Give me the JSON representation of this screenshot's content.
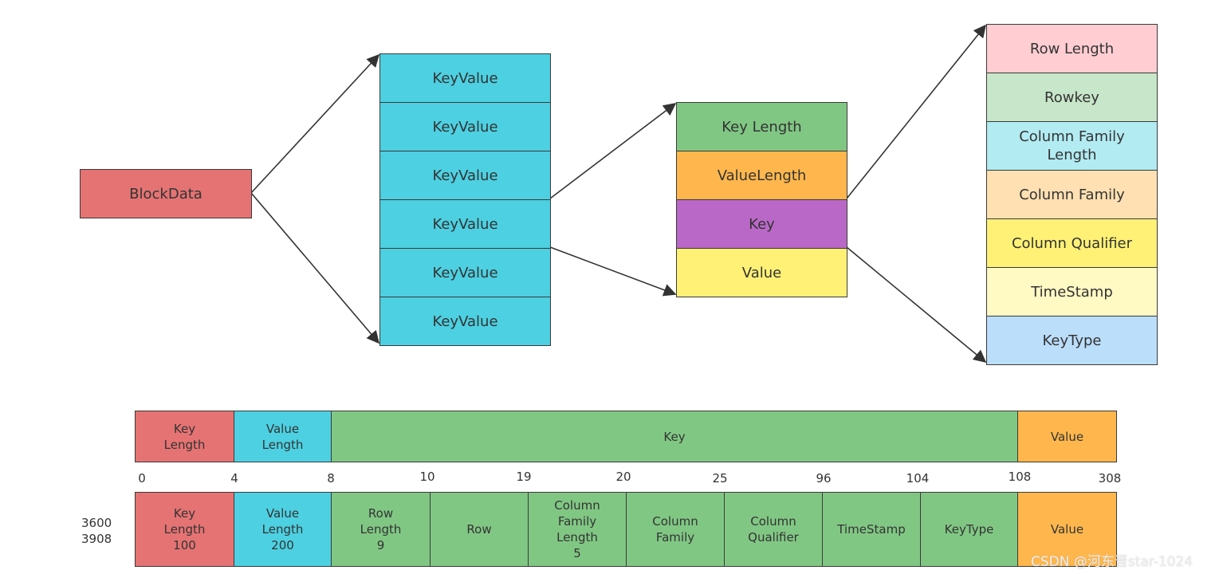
{
  "colors": {
    "red": "#e57373",
    "cyan": "#4dd0e1",
    "green": "#81c784",
    "orange": "#ffb74d",
    "purple": "#ba68c8",
    "yellow": "#fff176",
    "pink": "#ffcdd2",
    "lightgreen": "#c8e6c9",
    "lightcyan": "#b2ebf2",
    "peach": "#ffe0b2",
    "lightyellow": "#fff9c4",
    "lightblue": "#bbdefb"
  },
  "block": {
    "label": "BlockData"
  },
  "keyvalues": [
    "KeyValue",
    "KeyValue",
    "KeyValue",
    "KeyValue",
    "KeyValue",
    "KeyValue"
  ],
  "kv_parts": [
    "Key Length",
    "ValueLength",
    "Key",
    "Value"
  ],
  "key_parts": [
    "Row Length",
    "Rowkey",
    "Column Family\nLength",
    "Column Family",
    "Column Qualifier",
    "TimeStamp",
    "KeyType"
  ],
  "layout_row": [
    "Key\nLength",
    "Value\nLength",
    "Key",
    "Value"
  ],
  "offsets": [
    "0",
    "4",
    "8",
    "10",
    "19",
    "20",
    "25",
    "96",
    "104",
    "108",
    "308"
  ],
  "example_row": [
    "Key\nLength\n100",
    "Value\nLength\n200",
    "Row\nLength\n9",
    "Row",
    "Column\nFamily\nLength\n5",
    "Column\nFamily",
    "Column\nQualifier",
    "TimeStamp",
    "KeyType",
    "Value"
  ],
  "example_offsets": "3600\n3908",
  "watermark": "CSDN @河东晋star-1024"
}
